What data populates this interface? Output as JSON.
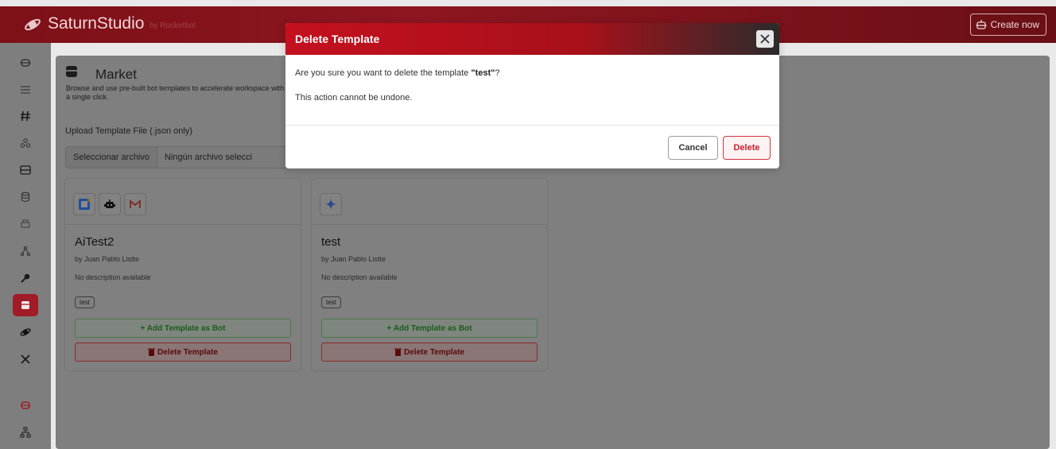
{
  "app": {
    "brand": "SaturnStudio",
    "brand_sub": "by Rocketbot",
    "create_label": "Create now",
    "logo_icon": "saturn-logo-icon"
  },
  "sidebar": {
    "items": [
      {
        "icon": "robot-icon",
        "active": false
      },
      {
        "icon": "flow-icon",
        "active": false
      },
      {
        "icon": "hash-icon",
        "active": false
      },
      {
        "icon": "users-icon",
        "active": false
      },
      {
        "icon": "layout-icon",
        "active": false
      },
      {
        "icon": "database-icon",
        "active": false
      },
      {
        "icon": "printer-icon",
        "active": false
      },
      {
        "icon": "network-icon",
        "active": false
      },
      {
        "icon": "key-icon",
        "active": false
      },
      {
        "icon": "store-icon",
        "active": true
      },
      {
        "icon": "saturn-icon",
        "active": false
      },
      {
        "icon": "tools-icon",
        "active": false
      },
      {
        "icon": "bot-red-icon",
        "active": false
      },
      {
        "icon": "sitemap-icon",
        "active": false
      }
    ]
  },
  "market": {
    "title": "Market",
    "description": "Browse and use pre-built bot templates to accelerate workspace with a single click.",
    "upload_label": "Upload Template File (.json only)",
    "file_button": "Seleccionar archivo",
    "file_name": "Ningún archivo selecci"
  },
  "cards": [
    {
      "title": "AiTest2",
      "author": "by Juan Pablo Listte",
      "description": "No description available",
      "tag": "test",
      "add_label": "+ Add Template as Bot",
      "delete_label": "Delete Template",
      "icons": [
        "calendar-icon",
        "bot-icon",
        "gmail-icon"
      ]
    },
    {
      "title": "test",
      "author": "by Juan Pablo Listte",
      "description": "No description available",
      "tag": "test",
      "add_label": "+ Add Template as Bot",
      "delete_label": "Delete Template",
      "icons": [
        "sparkle-icon"
      ]
    }
  ],
  "modal": {
    "title": "Delete Template",
    "question_prefix": "Are you sure you want to delete the template ",
    "template_name": "\"test\"",
    "question_suffix": "?",
    "warning": "This action cannot be undone.",
    "cancel_label": "Cancel",
    "delete_label": "Delete"
  },
  "colors": {
    "brand_red": "#c4101e",
    "overlay_gray": "#7f7f7f",
    "add_green": "#1a5c1a",
    "delete_red": "#c81e2c"
  }
}
